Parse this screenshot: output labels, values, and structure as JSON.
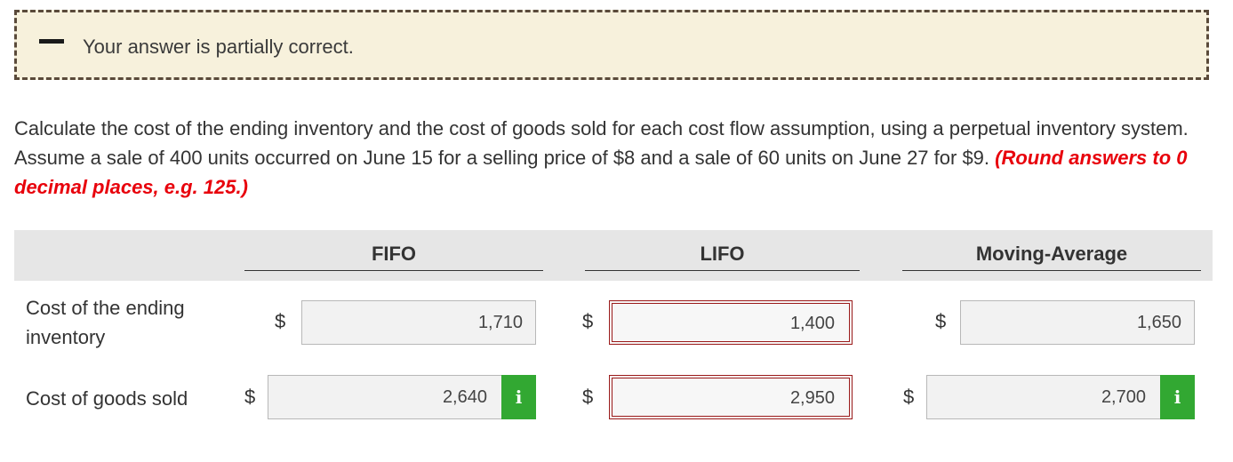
{
  "banner": {
    "message": "Your answer is partially correct."
  },
  "question": {
    "text": "Calculate the cost of the ending inventory and the cost of goods sold for each cost flow assumption, using a perpetual inventory system. Assume a sale of 400 units occurred on June 15 for a selling price of $8 and a sale of 60 units on June 27 for $9. ",
    "hint": "(Round answers to 0 decimal places, e.g. 125.)"
  },
  "columns": [
    "FIFO",
    "LIFO",
    "Moving-Average"
  ],
  "rows": [
    {
      "label": "Cost of the ending inventory",
      "values": [
        "1,710",
        "1,400",
        "1,650"
      ]
    },
    {
      "label": "Cost of goods sold",
      "values": [
        "2,640",
        "2,950",
        "2,700"
      ]
    }
  ],
  "currency_symbol": "$",
  "info_label": "i",
  "colors": {
    "correct_info": "#32a832",
    "incorrect_border": "#9b1b1b",
    "hint": "#e8000b"
  }
}
